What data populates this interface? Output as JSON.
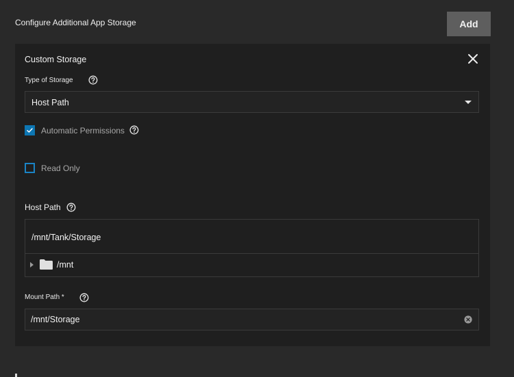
{
  "section": {
    "title": "Configure Additional App Storage",
    "add_label": "Add"
  },
  "card": {
    "title": "Custom Storage",
    "close_icon": "close-icon",
    "type_of_storage": {
      "label": "Type of Storage",
      "selected": "Host Path",
      "help_icon": "help-circle-icon"
    },
    "automatic_permissions": {
      "label": "Automatic Permissions",
      "checked": true
    },
    "read_only": {
      "label": "Read Only",
      "checked": false
    },
    "host_path": {
      "label": "Host Path",
      "value": "/mnt/Tank/Storage",
      "tree_root": "/mnt",
      "folder_icon": "folder-icon"
    },
    "mount_path": {
      "label": "Mount Path *",
      "value": "/mnt/Storage",
      "clear_icon": "clear-circle-icon"
    }
  },
  "colors": {
    "page_bg": "#292929",
    "card_bg": "#1f1f1f",
    "accent": "#0d76b3",
    "button_bg": "#5e5e5e"
  }
}
